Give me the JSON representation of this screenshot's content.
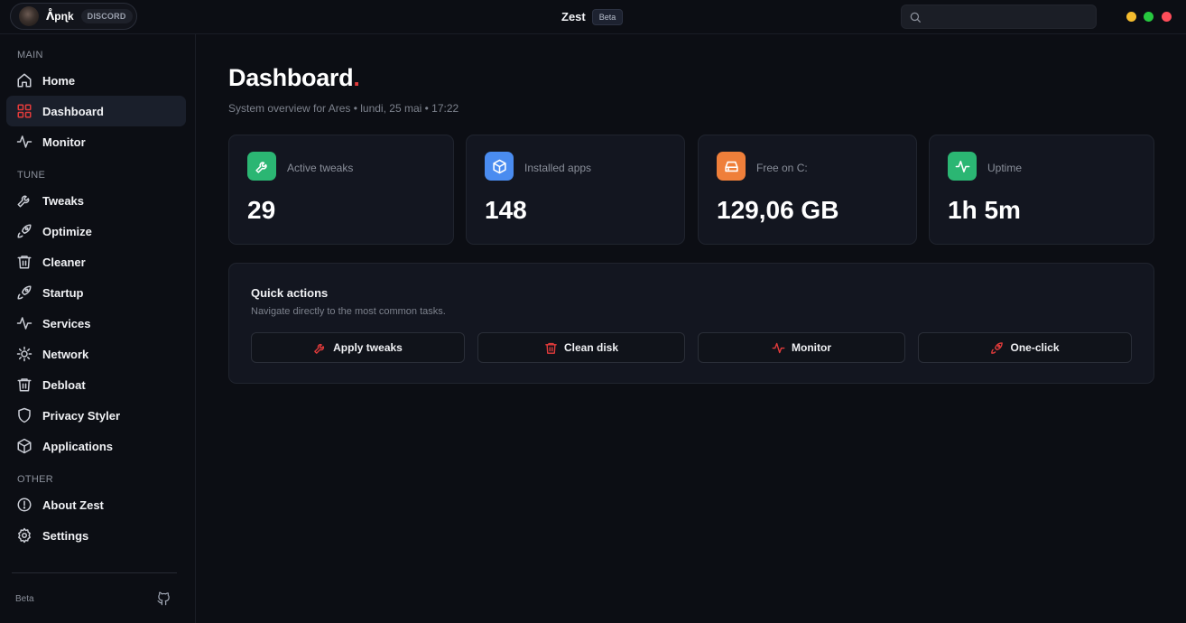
{
  "titlebar": {
    "profile_name": "ᐰpɳk",
    "discord_label": "DISCORD",
    "app_title": "Zest",
    "beta_label": "Beta",
    "search_placeholder": ""
  },
  "sidebar": {
    "sections": [
      {
        "label": "MAIN",
        "items": [
          {
            "label": "Home",
            "icon": "home-icon"
          },
          {
            "label": "Dashboard",
            "icon": "grid-icon",
            "active": true
          },
          {
            "label": "Monitor",
            "icon": "pulse-icon"
          }
        ]
      },
      {
        "label": "TUNE",
        "items": [
          {
            "label": "Tweaks",
            "icon": "wrench-icon"
          },
          {
            "label": "Optimize",
            "icon": "rocket-icon"
          },
          {
            "label": "Cleaner",
            "icon": "trash-icon"
          },
          {
            "label": "Startup",
            "icon": "rocket-icon"
          },
          {
            "label": "Services",
            "icon": "pulse-icon"
          },
          {
            "label": "Network",
            "icon": "sun-icon"
          },
          {
            "label": "Debloat",
            "icon": "trash-icon"
          },
          {
            "label": "Privacy Styler",
            "icon": "shield-icon"
          },
          {
            "label": "Applications",
            "icon": "package-icon"
          }
        ]
      },
      {
        "label": "OTHER",
        "items": [
          {
            "label": "About Zest",
            "icon": "info-icon"
          },
          {
            "label": "Settings",
            "icon": "gear-icon"
          }
        ]
      }
    ],
    "footer_label": "Beta",
    "footer_icon": "github-icon"
  },
  "main": {
    "title": "Dashboard",
    "title_accent": ".",
    "subtitle": "System overview for Ares • lundi, 25 mai • 17:22",
    "stats": [
      {
        "label": "Active tweaks",
        "value": "29",
        "icon": "wrench-icon",
        "color": "#2bb673"
      },
      {
        "label": "Installed apps",
        "value": "148",
        "icon": "package-icon",
        "color": "#4a8cf0"
      },
      {
        "label": "Free on C:",
        "value": "129,06 GB",
        "icon": "drive-icon",
        "color": "#ef7f3a"
      },
      {
        "label": "Uptime",
        "value": "1h 5m",
        "icon": "pulse-icon",
        "color": "#2bb673"
      }
    ],
    "quick_actions": {
      "title": "Quick actions",
      "subtitle": "Navigate directly to the most common tasks.",
      "buttons": [
        {
          "label": "Apply tweaks",
          "icon": "wrench-icon"
        },
        {
          "label": "Clean disk",
          "icon": "trash-icon"
        },
        {
          "label": "Monitor",
          "icon": "pulse-icon"
        },
        {
          "label": "One-click",
          "icon": "rocket-icon"
        }
      ]
    }
  },
  "colors": {
    "accent_red": "#e23b3b",
    "background": "#0c0e14",
    "card": "#131620"
  }
}
